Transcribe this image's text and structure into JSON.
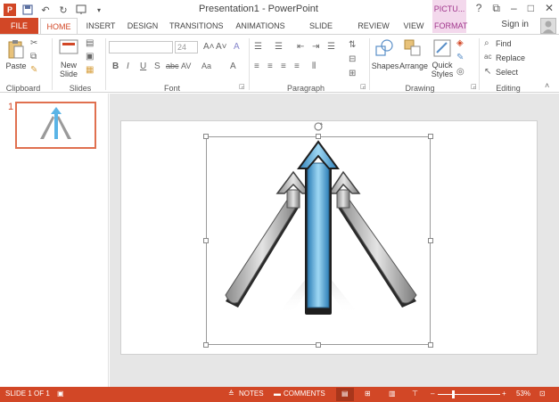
{
  "window": {
    "title": "Presentation1 - PowerPoint",
    "context_tab": "PICTU...",
    "help": "?",
    "restore": "⧉",
    "minimize": "–",
    "maximize": "□",
    "close": "✕"
  },
  "qat": {
    "icons": [
      "powerpoint-logo-icon",
      "save-icon",
      "undo-icon",
      "redo-icon",
      "start-from-beginning-icon",
      "customize-icon"
    ]
  },
  "tabs": [
    "FILE",
    "HOME",
    "INSERT",
    "DESIGN",
    "TRANSITIONS",
    "ANIMATIONS",
    "SLIDE SHOW",
    "REVIEW",
    "VIEW",
    "FORMAT"
  ],
  "signin": "Sign in",
  "ribbon": {
    "clipboard": {
      "label": "Clipboard",
      "paste": "Paste"
    },
    "slides": {
      "label": "Slides",
      "new_slide_1": "New",
      "new_slide_2": "Slide"
    },
    "font": {
      "label": "Font",
      "size": "24",
      "bold": "B",
      "italic": "I",
      "underline": "U",
      "shadow": "S",
      "strike": "abc",
      "spacing": "AV",
      "case": "Aa",
      "color": "A",
      "grow": "A˄",
      "shrink": "A˅",
      "clear": "A"
    },
    "paragraph": {
      "label": "Paragraph"
    },
    "drawing": {
      "label": "Drawing",
      "shapes": "Shapes",
      "arrange": "Arrange",
      "quick_1": "Quick",
      "quick_2": "Styles"
    },
    "editing": {
      "label": "Editing",
      "find": "Find",
      "replace": "Replace",
      "select": "Select"
    }
  },
  "thumbs": [
    {
      "number": "1"
    }
  ],
  "status": {
    "slide": "SLIDE 1 OF 1",
    "notes": "NOTES",
    "comments": "COMMENTS",
    "zoom": "53%"
  },
  "colors": {
    "accent": "#d24726",
    "context": "#a0368c",
    "arrow_blue": "#5ab4e6",
    "arrow_gray": "#c8c8c8"
  }
}
